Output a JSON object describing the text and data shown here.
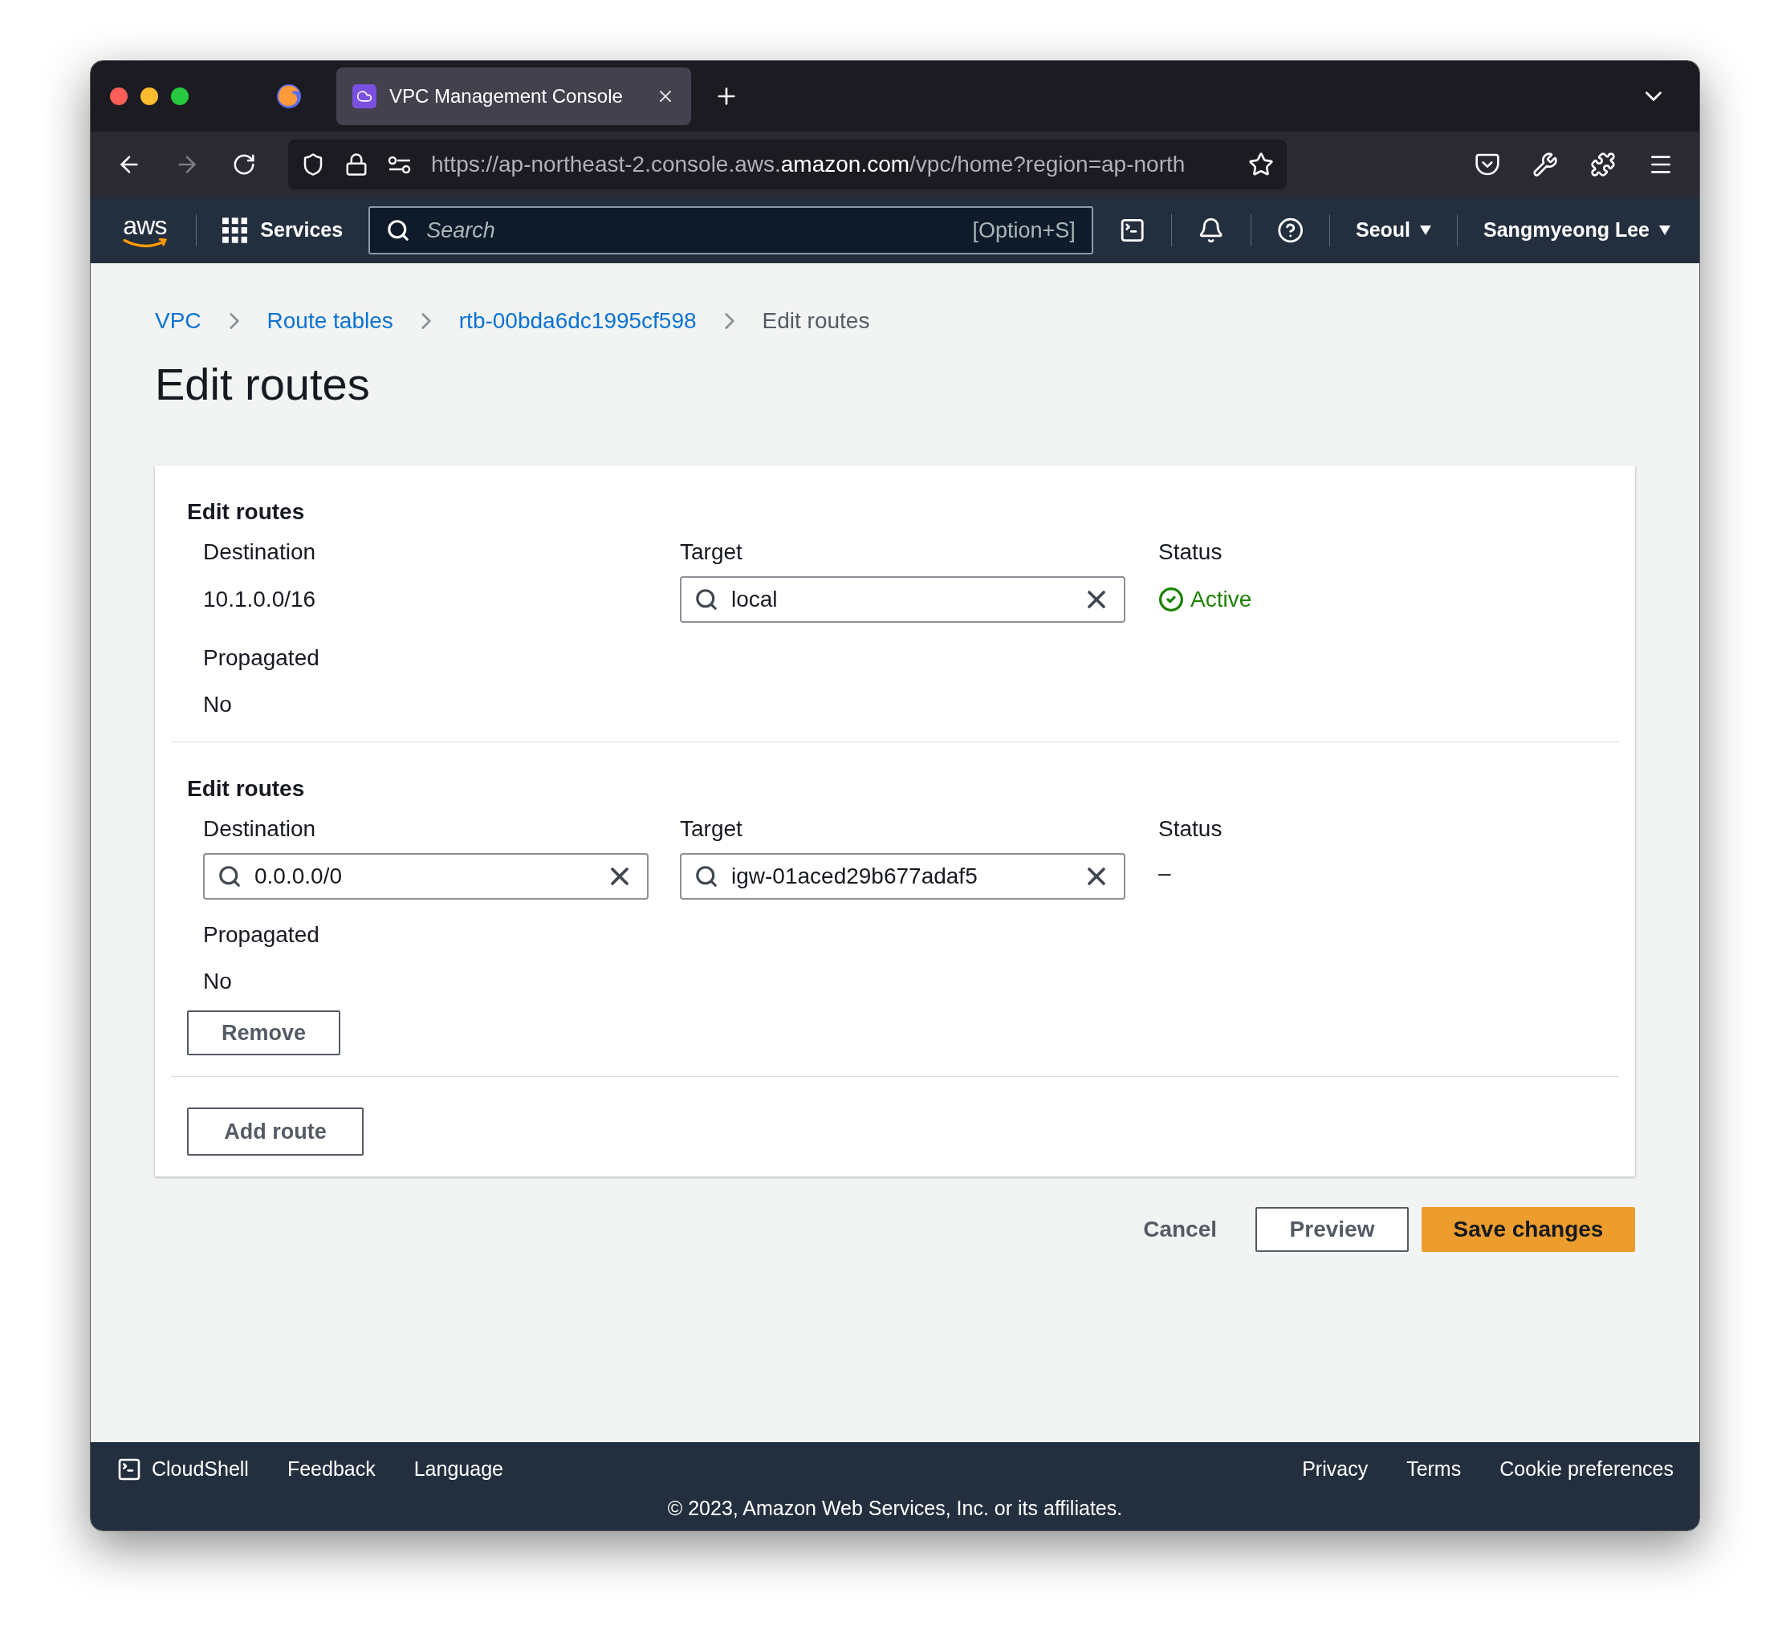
{
  "browser": {
    "tab": {
      "title": "VPC Management Console",
      "selected": true
    },
    "url": {
      "prefix": "https://ap-northeast-2.console.aws.",
      "domain": "amazon.com",
      "path": "/vpc/home?region=ap-north"
    }
  },
  "aws_nav": {
    "logo_text": "aws",
    "services": "Services",
    "search_placeholder": "Search",
    "search_shortcut": "[Option+S]",
    "region": "Seoul",
    "user": "Sangmyeong Lee"
  },
  "breadcrumbs": [
    {
      "label": "VPC",
      "kind": "link"
    },
    {
      "label": "Route tables",
      "kind": "link"
    },
    {
      "label": "rtb-00bda6dc1995cf598",
      "kind": "link"
    },
    {
      "label": "Edit routes",
      "kind": "current"
    }
  ],
  "title": "Edit routes",
  "routes": [
    {
      "heading": "Edit routes",
      "destination_label": "Destination",
      "destination": {
        "kind": "text",
        "value": "10.1.0.0/16"
      },
      "target_label": "Target",
      "target": {
        "kind": "field",
        "value": "local"
      },
      "status_label": "Status",
      "status": {
        "kind": "active",
        "text": "Active"
      },
      "propagated_label": "Propagated",
      "propagated": "No"
    },
    {
      "heading": "Edit routes",
      "destination_label": "Destination",
      "destination": {
        "kind": "field",
        "value": "0.0.0.0/0"
      },
      "target_label": "Target",
      "target": {
        "kind": "field",
        "value": "igw-01aced29b677adaf5"
      },
      "status_label": "Status",
      "status": {
        "kind": "none",
        "text": "–"
      },
      "propagated_label": "Propagated",
      "propagated": "No",
      "remove_button": "Remove"
    }
  ],
  "add_route_button": "Add route",
  "actions": {
    "cancel": "Cancel",
    "preview": "Preview",
    "save": "Save changes"
  },
  "footer": {
    "left": [
      "CloudShell",
      "Feedback",
      "Language"
    ],
    "right": [
      "Privacy",
      "Terms",
      "Cookie preferences"
    ],
    "copyright": "© 2023, Amazon Web Services, Inc. or its affiliates."
  }
}
